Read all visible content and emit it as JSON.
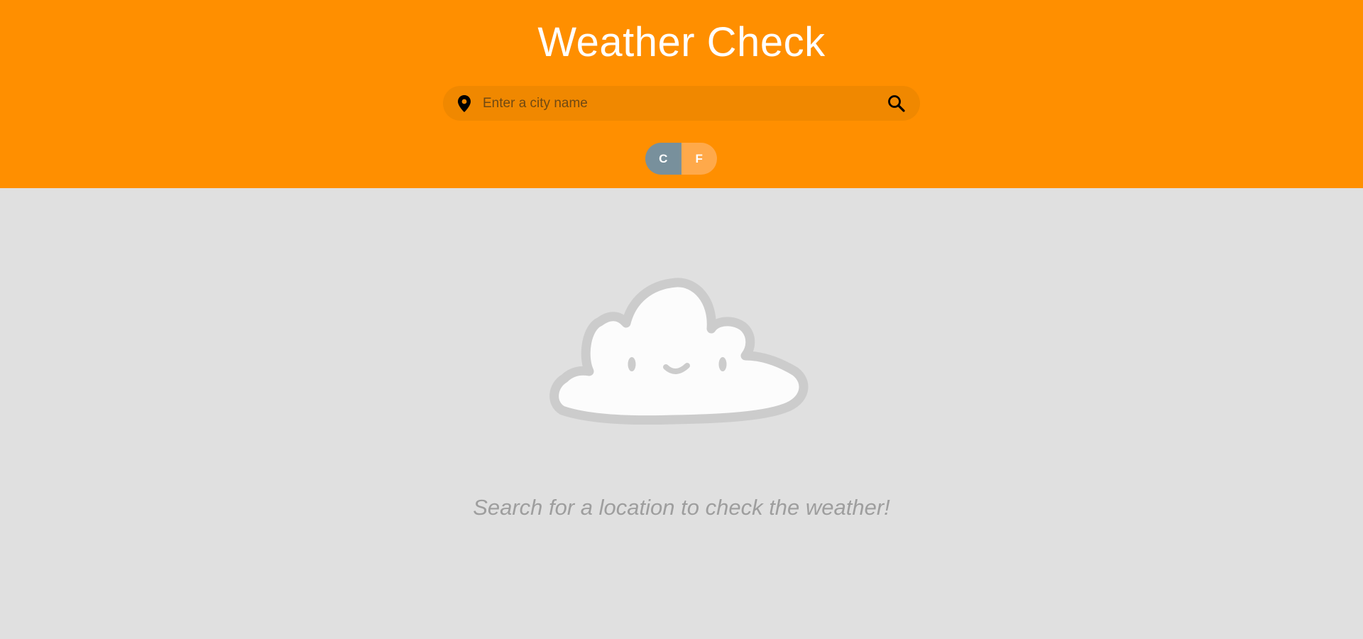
{
  "header": {
    "title": "Weather Check",
    "background_color": "#ff8f00"
  },
  "search": {
    "placeholder": "Enter a city name",
    "value": "",
    "location_icon": "location-pin-icon",
    "search_icon": "search-icon"
  },
  "units": {
    "celsius_label": "C",
    "fahrenheit_label": "F",
    "selected": "C"
  },
  "empty_state": {
    "illustration": "smiling-cloud",
    "message": "Search for a location to check the weather!"
  }
}
